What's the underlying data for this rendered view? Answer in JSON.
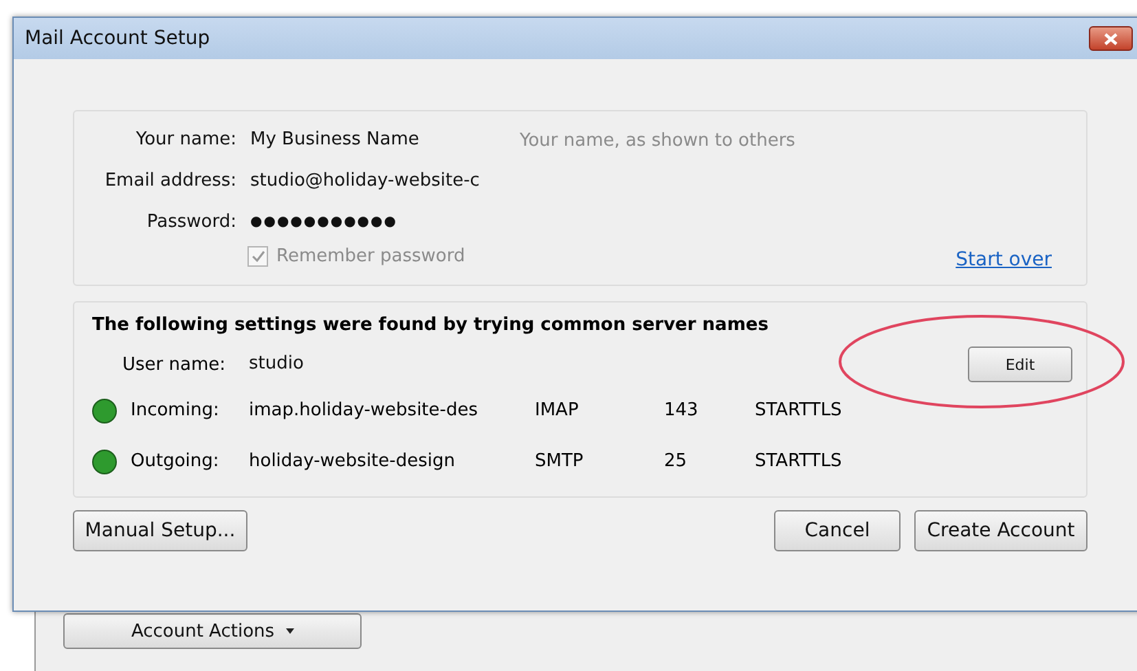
{
  "window": {
    "title": "Mail Account Setup"
  },
  "account": {
    "fields": [
      {
        "label": "Your name:",
        "value": "My Business Name",
        "hint": "Your name, as shown to others"
      },
      {
        "label": "Email address:",
        "value": "studio@holiday-website-c"
      },
      {
        "label": "Password:",
        "value": "●●●●●●●●●●●"
      }
    ],
    "remember_password": {
      "label": "Remember password",
      "checked": true,
      "disabled": true
    },
    "start_over": "Start over"
  },
  "settings": {
    "heading": "The following settings were found by trying common server names",
    "user_label": "User name:",
    "user_value": "studio",
    "edit_button": "Edit",
    "servers": [
      {
        "label": "Incoming:",
        "host": "imap.holiday-website-des",
        "protocol": "IMAP",
        "port": "143",
        "security": "STARTTLS",
        "color": "#2e9a2e"
      },
      {
        "label": "Outgoing:",
        "host": "holiday-website-design",
        "protocol": "SMTP",
        "port": "25",
        "security": "STARTTLS",
        "color": "#2e9a2e"
      }
    ]
  },
  "buttons": {
    "manual": "Manual Setup...",
    "cancel": "Cancel",
    "create": "Create Account"
  },
  "background": {
    "account_actions": "Account Actions"
  }
}
